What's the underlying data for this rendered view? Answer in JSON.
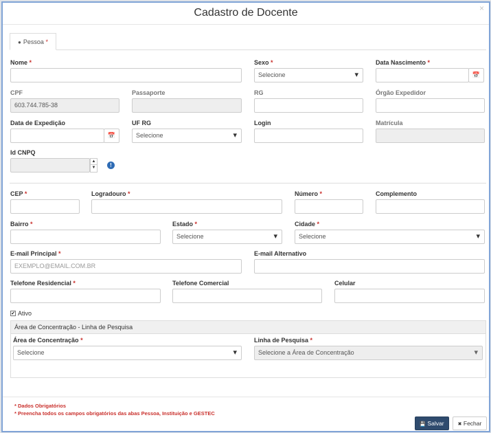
{
  "modal": {
    "title": "Cadastro de Docente",
    "close": "×"
  },
  "tabs": [
    {
      "label": "Pessoa",
      "required_mark": "*",
      "icon": "user-icon"
    }
  ],
  "required_mark": "*",
  "fields": {
    "nome": {
      "label": "Nome",
      "value": ""
    },
    "sexo": {
      "label": "Sexo",
      "value": "Selecione"
    },
    "data_nascimento": {
      "label": "Data Nascimento",
      "value": ""
    },
    "cpf": {
      "label": "CPF",
      "value": "603.744.785-38"
    },
    "passaporte": {
      "label": "Passaporte",
      "value": ""
    },
    "rg": {
      "label": "RG",
      "value": ""
    },
    "orgao_expedidor": {
      "label": "Órgão Expedidor",
      "value": ""
    },
    "data_expedicao": {
      "label": "Data de Expedição",
      "value": ""
    },
    "uf_rg": {
      "label": "UF RG",
      "value": "Selecione"
    },
    "login": {
      "label": "Login",
      "value": ""
    },
    "matricula": {
      "label": "Matrícula",
      "value": ""
    },
    "id_cnpq": {
      "label": "Id CNPQ",
      "value": ""
    },
    "cep": {
      "label": "CEP",
      "value": ""
    },
    "logradouro": {
      "label": "Logradouro",
      "value": ""
    },
    "numero": {
      "label": "Número",
      "value": ""
    },
    "complemento": {
      "label": "Complemento",
      "value": ""
    },
    "bairro": {
      "label": "Bairro",
      "value": ""
    },
    "estado": {
      "label": "Estado",
      "value": "Selecione"
    },
    "cidade": {
      "label": "Cidade",
      "value": "Selecione"
    },
    "email_principal": {
      "label": "E-mail Principal",
      "placeholder": "EXEMPLO@EMAIL.COM.BR"
    },
    "email_alternativo": {
      "label": "E-mail Alternativo",
      "value": ""
    },
    "telefone_residencial": {
      "label": "Telefone Residencial",
      "value": ""
    },
    "telefone_comercial": {
      "label": "Telefone Comercial",
      "value": ""
    },
    "celular": {
      "label": "Celular",
      "value": ""
    }
  },
  "ativo": {
    "label": "Ativo",
    "checked": true,
    "mark": "✔"
  },
  "panel": {
    "title": "Área de Concentração - Linha de Pesquisa",
    "area": {
      "label": "Área de Concentração",
      "value": "Selecione"
    },
    "linha": {
      "label": "Linha de Pesquisa",
      "value": "Selecione a Área de Concentração"
    }
  },
  "footnotes": {
    "line1": "* Dados Obrigatórios",
    "line2": "* Preencha todos os campos obrigatórios das abas Pessoa, Instituição e GESTEC"
  },
  "buttons": {
    "save": "Salvar",
    "close": "Fechar"
  },
  "icons": {
    "calendar": "📅",
    "info": "!",
    "spin_up": "▲",
    "spin_down": "▼",
    "save_icon": "💾",
    "close_icon": "✖"
  },
  "colors": {
    "accent": "#2f4b6e",
    "required": "#c9302c",
    "border": "#7fa3d6"
  }
}
